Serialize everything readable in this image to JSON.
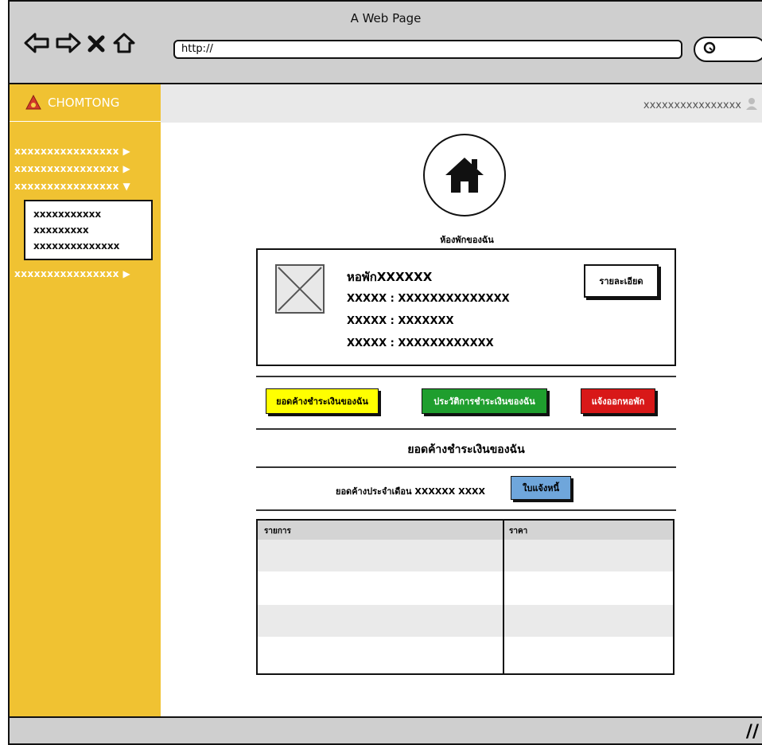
{
  "window": {
    "title": "A Web Page",
    "url": "http://"
  },
  "brand": {
    "name": "CHOMTONG"
  },
  "header": {
    "username": "xxxxxxxxxxxxxxxx"
  },
  "sidebar": {
    "items": [
      {
        "label": "xxxxxxxxxxxxxxxx"
      },
      {
        "label": "xxxxxxxxxxxxxxxx"
      },
      {
        "label": "xxxxxxxxxxxxxxxx"
      },
      {
        "label": "xxxxxxxxxxxxxxxx"
      }
    ],
    "submenu": [
      {
        "label": "xxxxxxxxxxx"
      },
      {
        "label": "xxxxxxxxx"
      },
      {
        "label": "xxxxxxxxxxxxxx"
      }
    ]
  },
  "main": {
    "caption": "ห้องพักของฉัน",
    "card": {
      "title": "หอพักXXXXXX",
      "line1": "XXXXX : XXXXXXXXXXXXXX",
      "line2": "XXXXX : XXXXXXX",
      "line3": "XXXXX : XXXXXXXXXXXX",
      "detail_button": "รายละเอียด"
    },
    "actions": {
      "outstanding": "ยอดค้างชำระเงินของฉัน",
      "history": "ประวัติการชำระเงินของฉัน",
      "move_out": "แจ้งออกหอพัก"
    },
    "section_title": "ยอดค้างชำระเงินของฉัน",
    "monthly_label": "ยอดค้างประจำเดือน XXXXXX XXXX",
    "invoice_button": "ใบแจ้งหนี้",
    "table": {
      "col_item": "รายการ",
      "col_price": "ราคา"
    }
  },
  "colors": {
    "sidebar": "#f0c232",
    "outstanding": "#ffff00",
    "history": "#1f9e2e",
    "move_out": "#d81818",
    "invoice": "#6fa6db"
  }
}
